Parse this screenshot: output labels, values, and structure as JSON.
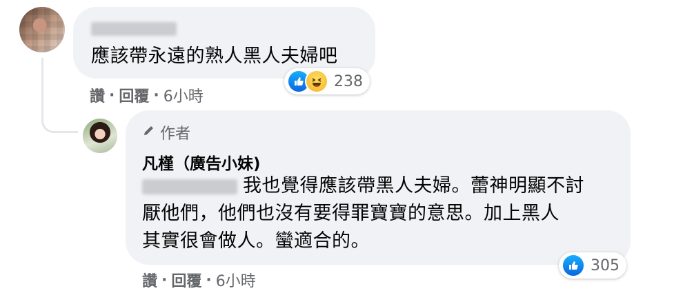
{
  "comment1": {
    "name_blurred": "Betty Mei",
    "text": "應該帶永遠的熟人黑人夫婦吧",
    "actions": {
      "like": "讚",
      "reply": "回覆",
      "sep": "·",
      "time": "6小時"
    },
    "reactions": {
      "icons": [
        "like-icon",
        "haha-icon"
      ],
      "count": "238"
    }
  },
  "reply1": {
    "author_tag": "作者",
    "author_name": "凡槿（廣告小妹)",
    "mention_blurred": "Betty Mei",
    "text_lines": [
      "我也覺得應該帶黑人夫婦。蕾神明顯不討",
      "厭他們，他們也沒有要得罪寶寶的意思。加上黑人",
      "其實很會做人。蠻適合的。"
    ],
    "actions": {
      "like": "讚",
      "reply": "回覆",
      "sep": "·",
      "time": "6小時"
    },
    "reactions": {
      "icons": [
        "like-icon"
      ],
      "count": "305"
    }
  },
  "colors": {
    "bubble": "#f0f2f5",
    "meta": "#65676b",
    "like_blue": "#0a66e0"
  }
}
